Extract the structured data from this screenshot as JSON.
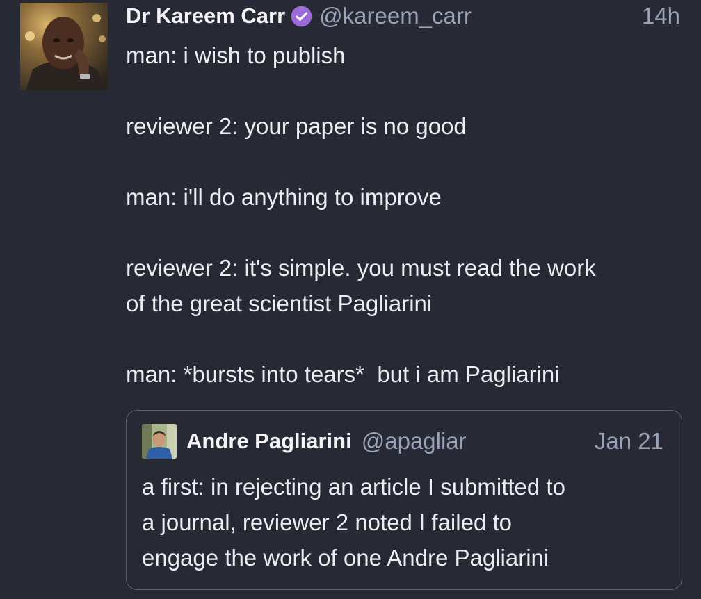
{
  "tweet": {
    "author": {
      "display_name": "Dr Kareem Carr",
      "handle": "@kareem_carr",
      "verified_icon": "verified-check-icon",
      "badge_color": "#9b6bd6"
    },
    "time": "14h",
    "text_lines": [
      "man: i wish to publish",
      "",
      "reviewer 2: your paper is no good",
      "",
      "man: i'll do anything to improve",
      "",
      "reviewer 2: it's simple. you must read the work",
      "of the great scientist Pagliarini",
      "",
      "man: *bursts into tears*  but i am Pagliarini"
    ]
  },
  "quote": {
    "author": {
      "display_name": "Andre Pagliarini",
      "handle": "@apagliar"
    },
    "time": "Jan 21",
    "text_lines": [
      "a first: in rejecting an article I submitted to",
      "a journal, reviewer 2 noted I failed to",
      "engage the work of one Andre Pagliarini"
    ]
  },
  "colors": {
    "background": "#272935",
    "text": "#ecedf1",
    "muted": "#9aa3b8",
    "quote_border": "#5c6070"
  }
}
